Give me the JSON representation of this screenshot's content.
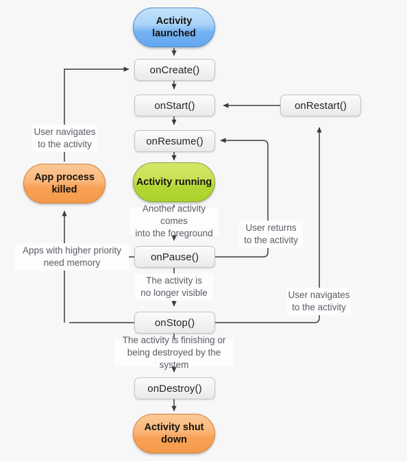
{
  "diagram": {
    "title": "Android Activity Lifecycle",
    "background_color": "#f7f7f7",
    "line_color": "#3a3a3a",
    "label_text_color": "#5b5b66",
    "node_text_color": "#23232b"
  },
  "states": {
    "activity_launched": "Activity\nlaunched",
    "activity_running": "Activity\nrunning",
    "app_process_killed": "App process\nkilled",
    "activity_shut_down": "Activity\nshut down"
  },
  "state_colors": {
    "activity_launched": "#8fc4f5",
    "activity_running": "#bcdb3f",
    "app_process_killed": "#f7a55d",
    "activity_shut_down": "#f7a55d"
  },
  "callbacks": {
    "on_create": "onCreate()",
    "on_start": "onStart()",
    "on_resume": "onResume()",
    "on_restart": "onRestart()",
    "on_pause": "onPause()",
    "on_stop": "onStop()",
    "on_destroy": "onDestroy()"
  },
  "edge_labels": {
    "user_navigates_left": "User navigates\nto the activity",
    "another_activity_foreground": "Another activity comes\ninto the foreground",
    "user_returns": "User returns\nto the activity",
    "apps_higher_priority": "Apps with higher priority\nneed memory",
    "no_longer_visible": "The activity is\nno longer visible",
    "user_navigates_right": "User navigates\nto the activity",
    "finishing_or_destroyed": "The activity is finishing or\nbeing destroyed by the system"
  }
}
